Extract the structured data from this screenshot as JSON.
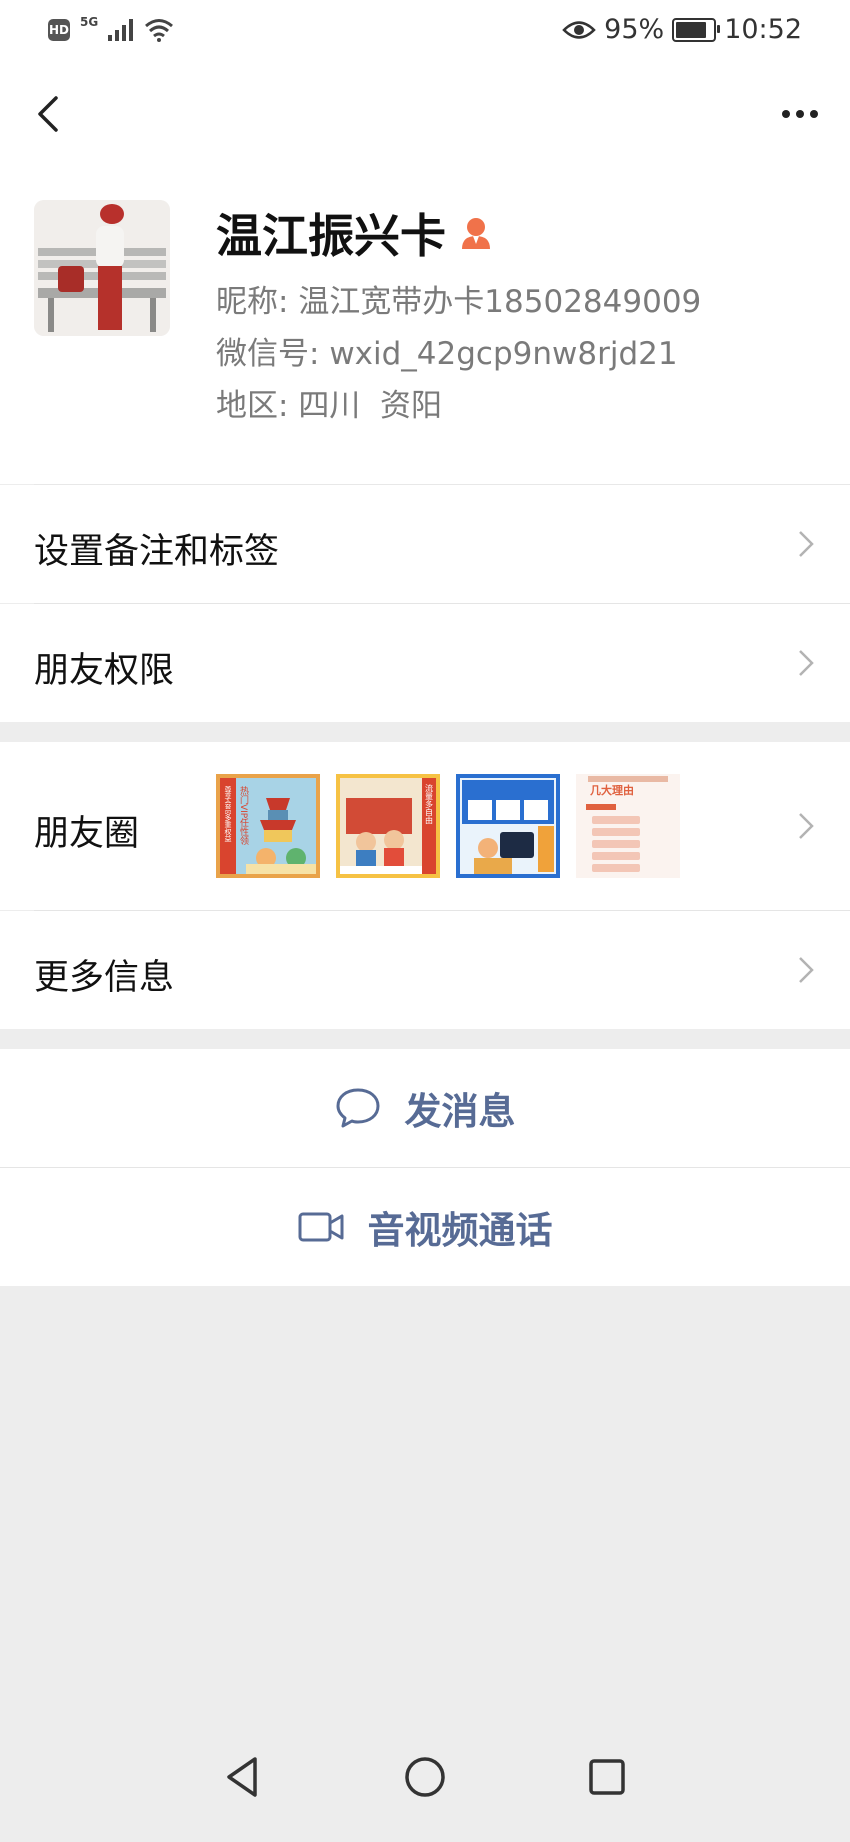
{
  "status_bar": {
    "hd": "HD",
    "network": "5G",
    "battery_percent": "95%",
    "battery_level": 0.95,
    "time": "10:52"
  },
  "profile": {
    "name": "温江振兴卡",
    "nickname_label": "昵称: ",
    "nickname": "温江宽带办卡18502849009",
    "wechat_id_label": "微信号: ",
    "wechat_id": "wxid_42gcp9nw8rjd21",
    "region_label": "地区: ",
    "region": "四川  资阳"
  },
  "menu": {
    "remark_tags": "设置备注和标签",
    "friend_permissions": "朋友权限",
    "moments": "朋友圈",
    "more_info": "更多信息"
  },
  "moments_thumbs": [
    {
      "caption": "热门VIP任性领",
      "sub": "尊享会员多重权益"
    },
    {
      "caption": "流量多自由",
      "sub": ""
    },
    {
      "caption": "",
      "sub": ""
    },
    {
      "caption": "几大理由",
      "sub": ""
    }
  ],
  "actions": {
    "send_message": "发消息",
    "video_call": "音视频通话"
  },
  "colors": {
    "link_blue": "#576b95",
    "badge_orange": "#f0724a",
    "page_bg": "#ededed"
  }
}
